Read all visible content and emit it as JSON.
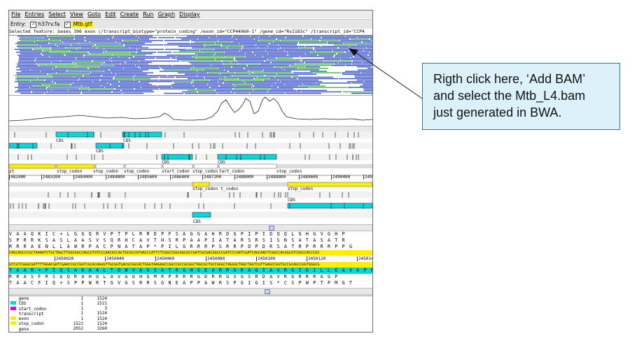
{
  "menu": [
    "File",
    "Entries",
    "Select",
    "View",
    "Goto",
    "Edit",
    "Create",
    "Run",
    "Graph",
    "Display"
  ],
  "entry_bar": {
    "label": "Entry:",
    "entries": [
      {
        "name": "h37rv.fa",
        "checked": true,
        "highlighted": false
      },
      {
        "name": "Mtb.gtf",
        "checked": true,
        "highlighted": true
      }
    ]
  },
  "selected_feature": "Selected feature:  bases 396  exon  (/transcript_biotype=\"protein_coding\" /exon_id=\"CCP44960-1\" /gene_id=\"Rv2183c\" /transcript_id=\"CCP4",
  "feature_labels_top": {
    "cds_a": "CDS",
    "cds_b": "CDS",
    "cds_c": "CDS",
    "cds_d": "CDS",
    "cds_e": "CDS"
  },
  "labels_row_top": [
    "pt",
    "stop_codon",
    "stop_codon",
    "stop_codon",
    "start_codon",
    "stop_codon",
    "tart_codon",
    "stop_codon"
  ],
  "ruler_top": [
    "482400",
    "2483200",
    "2484000",
    "2484800",
    "2485600",
    "2486400",
    "2487200",
    "2488000",
    "2488800",
    "2489600",
    "2490400",
    "249"
  ],
  "labels_row_bottom": [
    "stop_codon",
    "t_codon",
    "stop_codon"
  ],
  "cds_bottom": [
    "CDS",
    "CDS"
  ],
  "aa_frames_top": [
    "V A A Q K I C + L G G Q R V P T P L R R D P F S A G G A H R D G P I P I D Q Q L G H G V G H P",
    " S P R R K S A S L A A S V S Q R H C A V T H S R P A A P I A T A R S R S I S N S A T A S A T R",
    "R R R A E N L L A W R P A C P N A T A P * P I L G R R R P S R R P D P D R S A T R P R R R P P G"
  ],
  "dna_forward": "CAGCAGCCCGCTAAAATCTGCTAGCTTGGCGGCCAGCGTGTCCCAACGCCACTGCGCCGTGACCCATTCTCGGCCGGCGGCGCCGATCGCGACGGCCCGATCCCGATCGATCAGCAACTCGGCCACGGCGTCGGCCACCCGC",
  "ruler_dna": [
    "2450020",
    "2450040",
    "2450060",
    "2450080",
    "2450100",
    "2450120",
    "2450140"
  ],
  "dna_reverse": "GTCGTCGGGCGATTTTAGACGATCGAACCGCCGGTCGCACAGGGTTGCGGTGACGCGGCACTGGGTAAGAGCCGGCCGCCGCGGCTAGCGCTGCCGGGCTAGGGCTAGCTAGTCGTTGAGCCGGTGCCGCAGCCGGTGGGCG",
  "aa_frames_bottom": [
    " T A A R + F I Q S A K A A L T D W V A G S A T R G H G E A R R G R A G I A V R G I D I L L E A V A P R R G",
    " R R A S F R S A Q R A H G L A V A G H G M R P R R R G D R R G S G S R D A V R G R R R G G P",
    " T A A C F I Q + S P P W R T G V G S R R S G N E A P P A W R S P G I G I S * C S P W P T P M G T"
  ],
  "feature_list": [
    {
      "name": "gene",
      "start": "1",
      "end": "1524",
      "color": "#ffffff"
    },
    {
      "name": "CDS",
      "start": "1",
      "end": "1521",
      "color": "#00d8e0"
    },
    {
      "name": "start_codon",
      "start": "1",
      "end": "3",
      "color": "#e000e0"
    },
    {
      "name": "transcript",
      "start": "1",
      "end": "1524",
      "color": "#ffffff"
    },
    {
      "name": "exon",
      "start": "1",
      "end": "1524",
      "color": "#ffee00"
    },
    {
      "name": "stop_codon",
      "start": "1522",
      "end": "1524",
      "color": "#ffee00"
    },
    {
      "name": "gene",
      "start": "2052",
      "end": "3260",
      "color": "#ffffff"
    }
  ],
  "callout": {
    "line1": "Rigth click here, ‘Add BAM’",
    "line2": "and select the Mtb_L4.bam",
    "line3": "just generated in BWA."
  },
  "colors": {
    "read_blue": "#3b53c9",
    "read_green": "#3fb83f",
    "cds": "#00d8e0",
    "exon": "#ffee00",
    "callout_bg": "#dcf1fa",
    "callout_border": "#2d78a8"
  }
}
